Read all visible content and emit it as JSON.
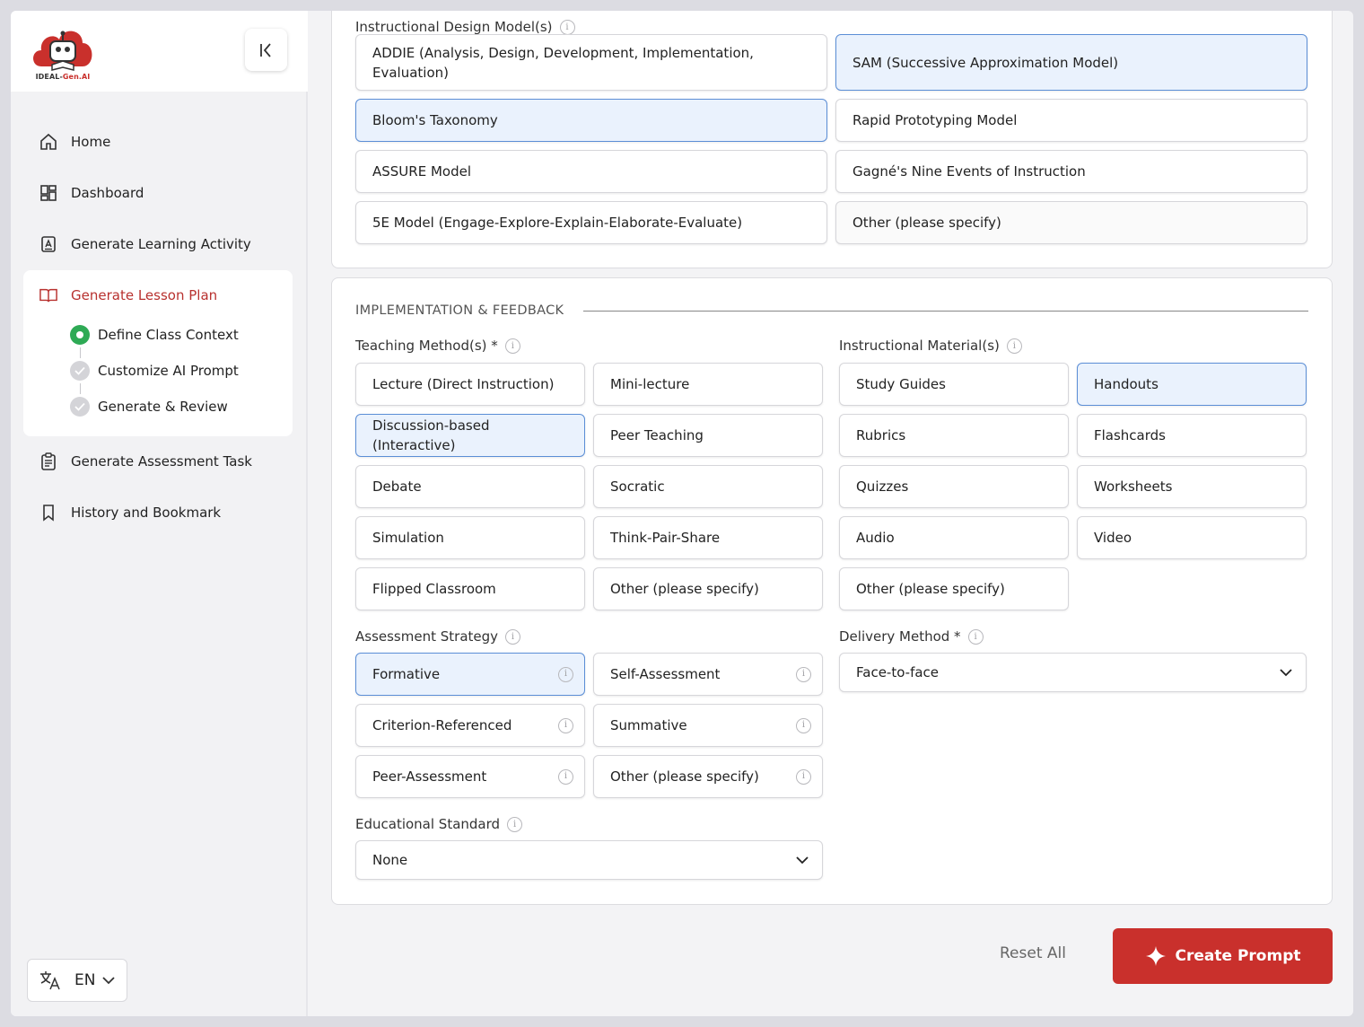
{
  "sidebar": {
    "logo_text_a": "IDEAL-",
    "logo_text_b": "Gen.AI",
    "nav": {
      "home": "Home",
      "dashboard": "Dashboard",
      "learning_activity": "Generate Learning Activity",
      "lesson_plan": "Generate Lesson Plan",
      "assessment_task": "Generate Assessment Task",
      "history": "History and Bookmark"
    },
    "steps": [
      "Define Class Context",
      "Customize AI Prompt",
      "Generate & Review"
    ],
    "language": "EN"
  },
  "design_models": {
    "label": "Instructional Design Model(s)",
    "options": [
      {
        "label": "ADDIE (Analysis, Design, Development, Implementation, Evaluation)",
        "selected": false
      },
      {
        "label": "SAM (Successive Approximation Model)",
        "selected": true
      },
      {
        "label": "Bloom's Taxonomy",
        "selected": true
      },
      {
        "label": "Rapid Prototyping Model",
        "selected": false
      },
      {
        "label": "ASSURE Model",
        "selected": false
      },
      {
        "label": "Gagné's Nine Events of Instruction",
        "selected": false
      },
      {
        "label": "5E Model (Engage-Explore-Explain-Elaborate-Evaluate)",
        "selected": false
      },
      {
        "label": "Other (please specify)",
        "selected": false
      }
    ]
  },
  "implementation": {
    "title": "IMPLEMENTATION & FEEDBACK",
    "teaching_methods": {
      "label": "Teaching Method(s) *",
      "options": [
        {
          "label": "Lecture (Direct Instruction)",
          "selected": false
        },
        {
          "label": "Mini-lecture",
          "selected": false
        },
        {
          "label": "Discussion-based (Interactive)",
          "selected": true
        },
        {
          "label": "Peer Teaching",
          "selected": false
        },
        {
          "label": "Debate",
          "selected": false
        },
        {
          "label": "Socratic",
          "selected": false
        },
        {
          "label": "Simulation",
          "selected": false
        },
        {
          "label": "Think-Pair-Share",
          "selected": false
        },
        {
          "label": "Flipped Classroom",
          "selected": false
        },
        {
          "label": "Other (please specify)",
          "selected": false
        }
      ]
    },
    "materials": {
      "label": "Instructional Material(s)",
      "options": [
        {
          "label": "Study Guides",
          "selected": false
        },
        {
          "label": "Handouts",
          "selected": true
        },
        {
          "label": "Rubrics",
          "selected": false
        },
        {
          "label": "Flashcards",
          "selected": false
        },
        {
          "label": "Quizzes",
          "selected": false
        },
        {
          "label": "Worksheets",
          "selected": false
        },
        {
          "label": "Audio",
          "selected": false
        },
        {
          "label": "Video",
          "selected": false
        },
        {
          "label": "Other (please specify)",
          "selected": false
        }
      ]
    },
    "assessment": {
      "label": "Assessment Strategy",
      "options": [
        {
          "label": "Formative",
          "selected": true
        },
        {
          "label": "Self-Assessment",
          "selected": false
        },
        {
          "label": "Criterion-Referenced",
          "selected": false
        },
        {
          "label": "Summative",
          "selected": false
        },
        {
          "label": "Peer-Assessment",
          "selected": false
        },
        {
          "label": "Other (please specify)",
          "selected": false
        }
      ]
    },
    "delivery": {
      "label": "Delivery Method *",
      "value": "Face-to-face"
    },
    "standard": {
      "label": "Educational Standard",
      "value": "None"
    }
  },
  "actions": {
    "reset": "Reset All",
    "create": "Create Prompt"
  },
  "colors": {
    "accent": "#c9302c",
    "selected_bg": "#eaf2fd",
    "selected_border": "#5b8ed6",
    "step_active": "#2eaa55"
  }
}
